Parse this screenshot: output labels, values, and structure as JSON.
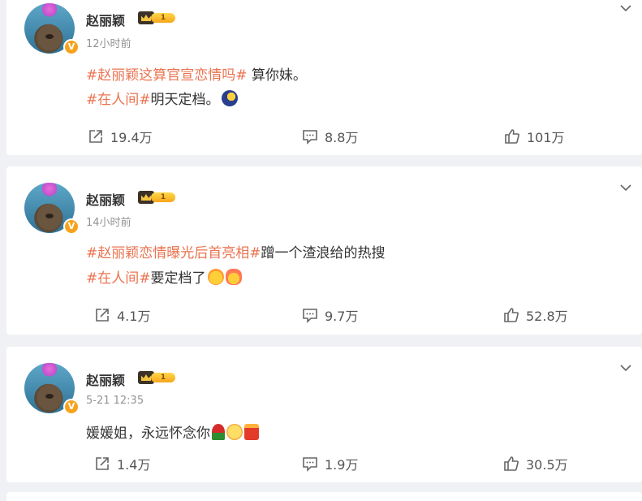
{
  "posts": [
    {
      "author": "赵丽颖",
      "level": "1",
      "badge": "V",
      "time": "12小时前",
      "lines": [
        {
          "tag": "#赵丽颖这算官宣恋情吗#",
          "text": " 算你妹。",
          "emojis": []
        },
        {
          "tag": "#在人间#",
          "text": "明天定档。",
          "emojis": [
            "moon-emoji"
          ]
        }
      ],
      "reposts": "19.4万",
      "comments": "8.8万",
      "likes": "101万"
    },
    {
      "author": "赵丽颖",
      "level": "1",
      "badge": "V",
      "time": "14小时前",
      "lines": [
        {
          "tag": "#赵丽颖恋情曝光后首亮相#",
          "text": "蹭一个渣浪给的热搜",
          "emojis": []
        },
        {
          "tag": "#在人间#",
          "text": "要定档了",
          "emojis": [
            "laugh-cry-emoji",
            "shock-emoji"
          ]
        }
      ],
      "reposts": "4.1万",
      "comments": "9.7万",
      "likes": "52.8万"
    },
    {
      "author": "赵丽颖",
      "level": "1",
      "badge": "V",
      "time": "5-21 12:35",
      "lines": [
        {
          "tag": "",
          "text": "媛媛姐，永远怀念你",
          "emojis": [
            "rose-emoji",
            "sad-emoji",
            "candle-emoji"
          ]
        }
      ],
      "reposts": "1.4万",
      "comments": "1.9万",
      "likes": "30.5万"
    }
  ],
  "icons": {
    "repost": "repost-icon",
    "comment": "comment-icon",
    "like": "thumb-up-icon",
    "more": "chevron-down-icon"
  },
  "colors": {
    "accent": "#eb7350",
    "background": "#f0f1f4",
    "verified": "#f7a21c"
  }
}
